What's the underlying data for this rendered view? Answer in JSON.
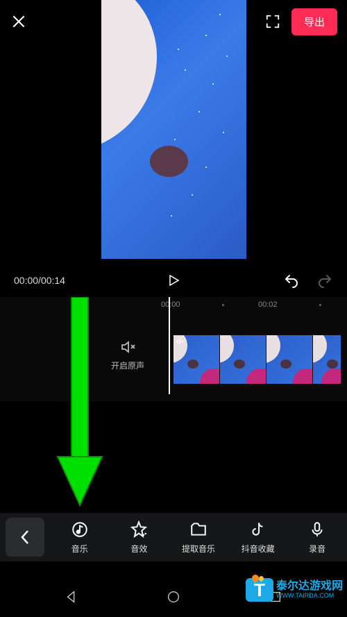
{
  "header": {
    "export_label": "导出"
  },
  "playback": {
    "current_time": "00:00",
    "total_time": "00:14"
  },
  "timeline": {
    "ruler": [
      "00:00",
      "00:02"
    ],
    "mute_label": "开启原声"
  },
  "tools": [
    {
      "id": "music",
      "label": "音乐"
    },
    {
      "id": "sfx",
      "label": "音效"
    },
    {
      "id": "extract",
      "label": "提取音乐"
    },
    {
      "id": "douyin",
      "label": "抖音收藏"
    },
    {
      "id": "record",
      "label": "录音"
    }
  ],
  "watermark": {
    "badge": "T",
    "main": "泰尔达游戏网",
    "sub": "WWW.TAIRDA.COM"
  },
  "colors": {
    "accent": "#fe2c55",
    "arrow": "#00ff00",
    "wm": "#1da9e6"
  }
}
